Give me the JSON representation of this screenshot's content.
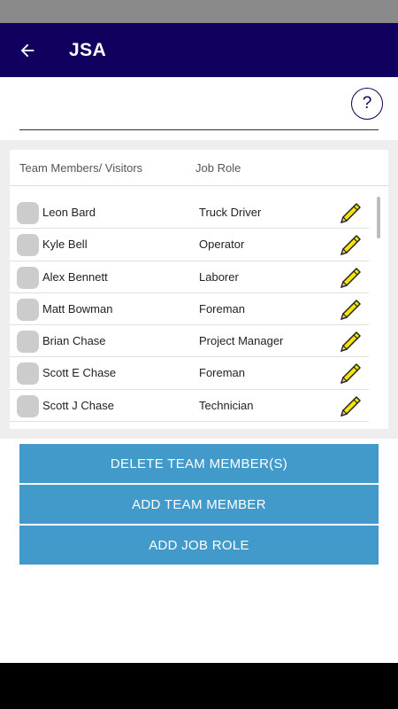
{
  "app_bar": {
    "title": "JSA"
  },
  "search": {
    "value": "",
    "placeholder": ""
  },
  "help": {
    "label": "?"
  },
  "table": {
    "headers": {
      "member": "Team Members/ Visitors",
      "role": "Job Role"
    },
    "rows": [
      {
        "name": "Leon Bard",
        "role": "Truck Driver"
      },
      {
        "name": "Kyle Bell",
        "role": "Operator"
      },
      {
        "name": "Alex Bennett",
        "role": "Laborer"
      },
      {
        "name": "Matt Bowman",
        "role": "Foreman"
      },
      {
        "name": "Brian Chase",
        "role": "Project Manager"
      },
      {
        "name": "Scott E Chase",
        "role": "Foreman"
      },
      {
        "name": "Scott J Chase",
        "role": "Technician"
      }
    ]
  },
  "buttons": {
    "delete": "DELETE TEAM MEMBER(S)",
    "add_member": "ADD TEAM MEMBER",
    "add_role": "ADD JOB ROLE"
  },
  "colors": {
    "app_bar": "#12005e",
    "button": "#419ac9",
    "checkbox": "#cccccc",
    "pencil": "#f5e600"
  },
  "icons": {
    "back": "arrow-left-icon",
    "edit": "pencil-icon",
    "help": "question-mark-icon"
  }
}
